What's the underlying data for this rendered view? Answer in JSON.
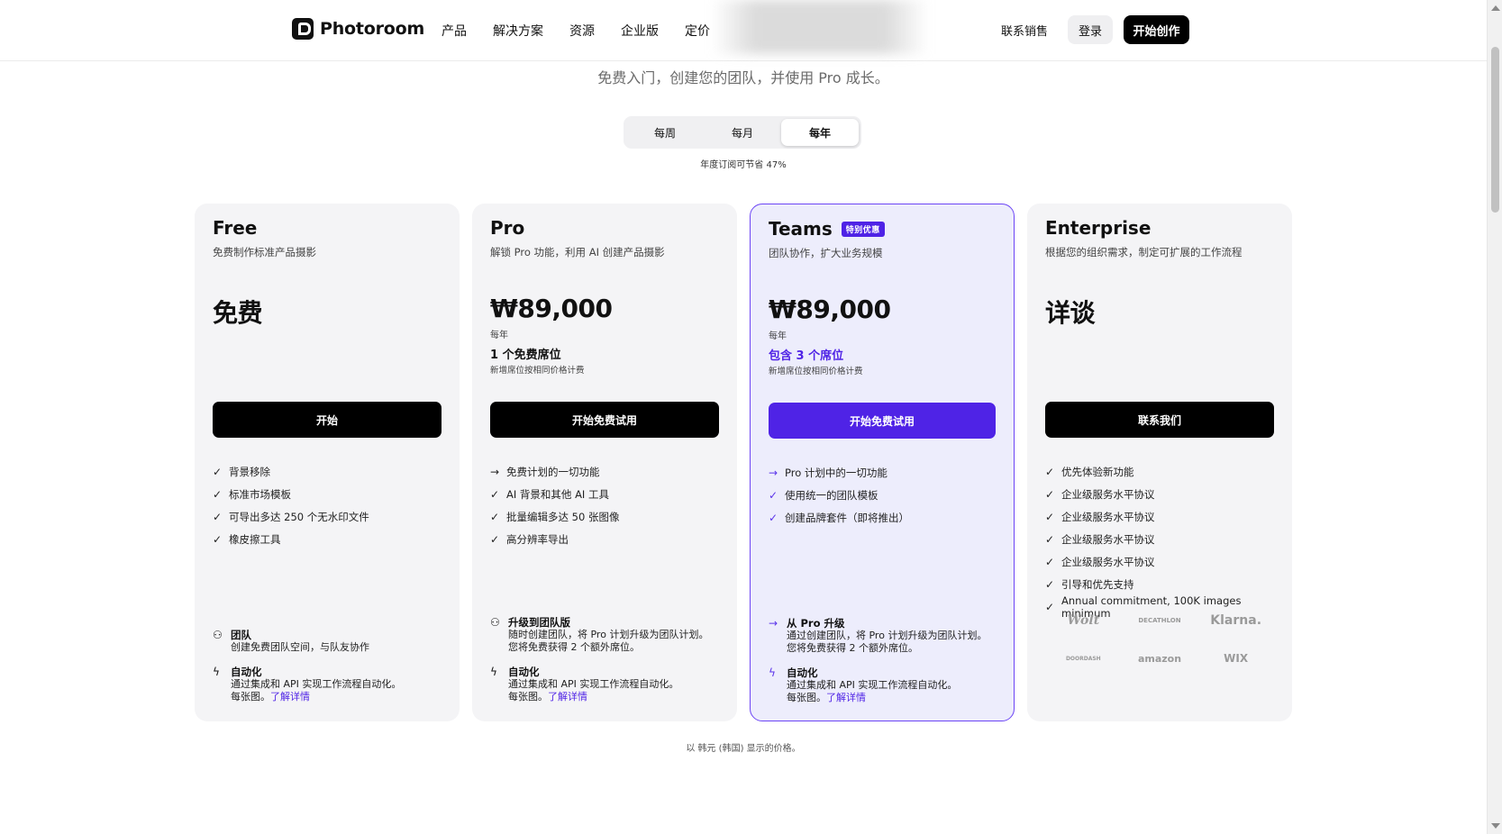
{
  "nav": {
    "brand": "Photoroom",
    "links": [
      "产品",
      "解决方案",
      "资源",
      "企业版",
      "定价"
    ],
    "contact_sales": "联系销售",
    "login": "登录",
    "start_creating": "开始创作"
  },
  "hero": {
    "subtitle": "免费入门，创建您的团队，并使用 Pro 成长。"
  },
  "billing": {
    "options": [
      "每周",
      "每月",
      "每年"
    ],
    "selected": "每年",
    "save_note": "年度订阅可节省 47%"
  },
  "plans": [
    {
      "name": "Free",
      "description": "免费制作标准产品摄影",
      "price": "免费",
      "cta": "开始",
      "features": [
        {
          "icon": "check-icon",
          "text": "背景移除"
        },
        {
          "icon": "check-icon",
          "text": "标准市场模板"
        },
        {
          "icon": "check-icon",
          "text": "可导出多达 250 个无水印文件"
        },
        {
          "icon": "check-icon",
          "text": "橡皮擦工具"
        }
      ],
      "extras": [
        {
          "icon": "users-icon",
          "title": "团队",
          "desc": [
            "创建免费团队空间，与队友协作"
          ]
        },
        {
          "icon": "lightning-icon",
          "title": "自动化",
          "desc": [
            "通过集成和 API 实现工作流程自动化。"
          ],
          "tail": "每张图。",
          "link": "了解详情"
        }
      ]
    },
    {
      "name": "Pro",
      "description": "解锁 Pro 功能，利用 AI 创建产品摄影",
      "price": "₩89,000",
      "period": "每年",
      "seats": "1 个免费席位",
      "seat_note": "新增席位按相同价格计费",
      "cta": "开始免费试用",
      "features": [
        {
          "icon": "arrow-right-icon",
          "text": "免费计划的一切功能"
        },
        {
          "icon": "check-icon",
          "text": "AI 背景和其他 AI 工具"
        },
        {
          "icon": "check-icon",
          "text": "批量编辑多达 50 张图像"
        },
        {
          "icon": "check-icon",
          "text": "高分辨率导出"
        }
      ],
      "extras": [
        {
          "icon": "users-icon",
          "title": "升级到团队版",
          "desc": [
            "随时创建团队，将 Pro 计划升级为团队计划。",
            "您将免费获得 2 个额外席位。"
          ]
        },
        {
          "icon": "lightning-icon",
          "title": "自动化",
          "desc": [
            "通过集成和 API 实现工作流程自动化。"
          ],
          "tail": "每张图。",
          "link": "了解详情"
        }
      ]
    },
    {
      "name": "Teams",
      "badge": "特别优惠",
      "description": "团队协作，扩大业务规模",
      "price": "₩89,000",
      "period": "每年",
      "seats": "包含 3 个席位",
      "seat_note": "新增席位按相同价格计费",
      "cta": "开始免费试用",
      "features": [
        {
          "icon": "arrow-right-icon",
          "text": "Pro 计划中的一切功能"
        },
        {
          "icon": "check-icon",
          "text": "使用统一的团队模板"
        },
        {
          "icon": "check-icon",
          "text": "创建品牌套件（即将推出）"
        }
      ],
      "extras": [
        {
          "icon": "arrow-right-icon",
          "title": "从 Pro 升级",
          "desc": [
            "通过创建团队，将 Pro 计划升级为团队计划。",
            "您将免费获得 2 个额外席位。"
          ]
        },
        {
          "icon": "lightning-icon",
          "title": "自动化",
          "desc": [
            "通过集成和 API 实现工作流程自动化。"
          ],
          "tail": "每张图。",
          "link": "了解详情"
        }
      ]
    },
    {
      "name": "Enterprise",
      "description": "根据您的组织需求，制定可扩展的工作流程",
      "price": "详谈",
      "cta": "联系我们",
      "features": [
        {
          "icon": "check-icon",
          "text": "优先体验新功能"
        },
        {
          "icon": "check-icon",
          "text": "企业级服务水平协议"
        },
        {
          "icon": "check-icon",
          "text": "企业级服务水平协议"
        },
        {
          "icon": "check-icon",
          "text": "企业级服务水平协议"
        },
        {
          "icon": "check-icon",
          "text": "企业级服务水平协议"
        },
        {
          "icon": "check-icon",
          "text": "引导和优先支持"
        },
        {
          "icon": "check-icon",
          "text": "Annual commitment, 100K images minimum"
        }
      ],
      "logos": [
        "Wolt",
        "DECATHLON",
        "Klarna.",
        "DOORDASH",
        "amazon",
        "WIX"
      ]
    }
  ],
  "footnote": "以 韩元 (韩国) 显示的价格。",
  "colors": {
    "accent": "#4f23e6",
    "teams_bg": "#ededfc",
    "card_bg": "#f4f4f6"
  }
}
